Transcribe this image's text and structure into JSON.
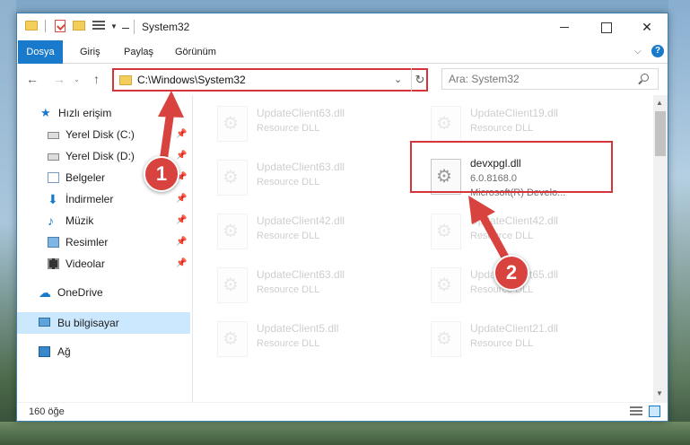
{
  "window": {
    "title": "System32",
    "ribbon_tabs": [
      "Dosya",
      "Giriş",
      "Paylaş",
      "Görünüm"
    ]
  },
  "address": {
    "path": "C:\\Windows\\System32",
    "search_placeholder": "Ara: System32"
  },
  "sidebar": {
    "items": [
      {
        "label": "Hızlı erişim",
        "icon": "star-icon",
        "pinned": false
      },
      {
        "label": "Yerel Disk (C:)",
        "icon": "drive-icon",
        "pinned": true
      },
      {
        "label": "Yerel Disk (D:)",
        "icon": "drive-icon",
        "pinned": true
      },
      {
        "label": "Belgeler",
        "icon": "documents-icon",
        "pinned": true
      },
      {
        "label": "İndirmeler",
        "icon": "download-icon",
        "pinned": true
      },
      {
        "label": "Müzik",
        "icon": "music-icon",
        "pinned": true
      },
      {
        "label": "Resimler",
        "icon": "pictures-icon",
        "pinned": true
      },
      {
        "label": "Videolar",
        "icon": "videos-icon",
        "pinned": true
      },
      {
        "label": "OneDrive",
        "icon": "cloud-icon",
        "pinned": false
      },
      {
        "label": "Bu bilgisayar",
        "icon": "computer-icon",
        "pinned": false,
        "selected": true
      },
      {
        "label": "Ağ",
        "icon": "network-icon",
        "pinned": false
      }
    ]
  },
  "files": {
    "left_column": [
      {
        "name": "UpdateClient63.dll",
        "type": "Resource DLL"
      },
      {
        "name": "UpdateClient63.dll",
        "type": "Resource DLL"
      },
      {
        "name": "UpdateClient42.dll",
        "type": "Resource DLL"
      },
      {
        "name": "UpdateClient63.dll",
        "type": "Resource DLL"
      },
      {
        "name": "UpdateClient5.dll",
        "type": "Resource DLL"
      }
    ],
    "right_column": [
      {
        "name": "UpdateClient19.dll",
        "type": "Resource DLL"
      },
      {
        "name": "UpdateClient42.dll",
        "type": "Resource DLL"
      },
      {
        "name": "UpdateClient65.dll",
        "type": "Resource DLL"
      },
      {
        "name": "UpdateClient21.dll",
        "type": "Resource DLL"
      }
    ],
    "highlighted": {
      "name": "devxpgl.dll",
      "version": "6.0.8168.0",
      "company": "Microsoft(R) Develo..."
    }
  },
  "status": {
    "count": "160 öğe"
  },
  "markers": {
    "first": "1",
    "second": "2"
  },
  "colors": {
    "accent": "#1979ca",
    "highlight": "#d5353a",
    "marker": "#d9433f"
  }
}
